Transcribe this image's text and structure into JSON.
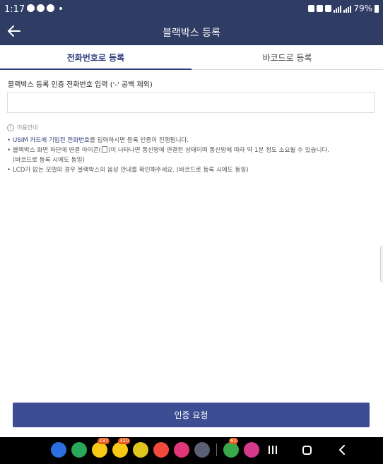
{
  "status_bar": {
    "time": "1:17",
    "battery": "79%"
  },
  "app_bar": {
    "title": "블랙박스 등록",
    "back_icon": "arrow-left-icon"
  },
  "tabs": [
    {
      "label": "전화번호로 등록",
      "active": true
    },
    {
      "label": "바코드로 등록",
      "active": false
    }
  ],
  "form": {
    "phone_label": "블랙박스 등록 인증 전화번호 입력 ('-' 공백 제외)",
    "phone_value": "",
    "phone_placeholder": ""
  },
  "notice": {
    "heading": "이용안내",
    "items": [
      {
        "highlight": "USIM 카드에 기입된 전화번호",
        "text": "를 입력하시면 등록 인증이 진행됩니다."
      },
      {
        "text_before": "블랙박스 화면 하단에 연결 아이콘(",
        "text_after": ")이 나타나면 통신망에 연결된 상태이며 통신망에 따라 약 1분 정도 소요될 수 있습니다.",
        "line2": "(바코드로 등록 시에도 동일)"
      },
      {
        "text": "LCD가 없는 모델의 경우 블랙박스의 음성 안내를 확인해주세요. (바코드로 등록 시에도 동일)"
      }
    ]
  },
  "submit_label": "인증 요청",
  "accent_colors": {
    "header": "#2f3c64",
    "tab_active": "#2f3f7e",
    "button": "#3d4d93"
  },
  "dock": {
    "apps": [
      {
        "name": "messages-icon",
        "color": "#2b6fe0"
      },
      {
        "name": "phone-icon",
        "color": "#2aa85a"
      },
      {
        "name": "talk-icon",
        "color": "#f6c916",
        "badge": "237"
      },
      {
        "name": "talk-icon-2",
        "color": "#f6c916",
        "badge": "320"
      },
      {
        "name": "chat-icon",
        "color": "#e0c51a"
      },
      {
        "name": "notes-icon",
        "color": "#f04a3c"
      },
      {
        "name": "flower-icon",
        "color": "#e0367a"
      },
      {
        "name": "apps-grid-icon",
        "color": "#5b5f73"
      }
    ],
    "recent_apps": [
      {
        "name": "calendar-icon",
        "color": "#39a84b",
        "badge": "61"
      },
      {
        "name": "instagram-icon",
        "color": "#d63a8a"
      }
    ]
  }
}
